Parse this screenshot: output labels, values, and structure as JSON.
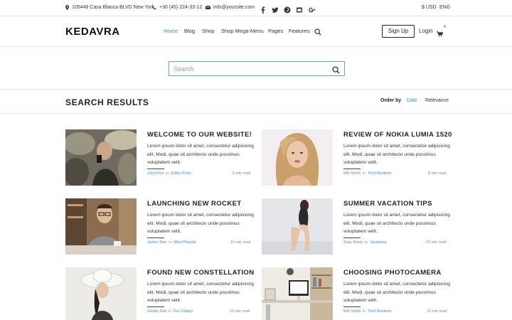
{
  "topbar": {
    "address": "105448 Casa Blanca BLVD New York",
    "phone": "+30 (45) 224-33-12",
    "email": "info@yoursite.com",
    "social": [
      "facebook-icon",
      "twitter-icon",
      "pinterest-icon",
      "youtube-icon",
      "google-plus-icon"
    ],
    "currency": "$ USD",
    "language": "ENG"
  },
  "header": {
    "logo": "KEDAVRA",
    "nav": [
      "Home",
      "Blog",
      "Shop",
      "Shop Mega-Menu",
      "Pages",
      "Features"
    ],
    "active_nav": "Home",
    "signup": "Sign Up",
    "login": "Login",
    "cart_count": "4"
  },
  "search": {
    "placeholder": "Search"
  },
  "results": {
    "title": "SEARCH RESULTS",
    "order_by_label": "Order by",
    "order_date": "Date",
    "order_sep": "-",
    "order_relevance": "Relevance"
  },
  "posts": [
    {
      "title": "WELCOME TO OUR WEBSITE!",
      "excerpt": "Lorem ipsum dolor sit amet, consectetur adipisicing elit. Modi, quae sit architecto unde possimus voluptatem velit.",
      "author": "John Doe",
      "in": "in",
      "category": "Editor Picks",
      "read": "5 min read"
    },
    {
      "title": "REVIEW OF NOKIA LUMIA 1520",
      "excerpt": "Lorem ipsum dolor sit amet, consectetur adipisicing elit. Modi, quae sit architecto unde possimus voluptatem velit.",
      "author": "Will Smith",
      "in": "in",
      "category": "Tech Reviews",
      "read": "8 min read"
    },
    {
      "title": "LAUNCHING NEW ROCKET",
      "excerpt": "Lorem ipsum dolor sit amet, consectetur adipisicing elit. Modi, quae sit architecto unde possimus voluptatem velit.",
      "author": "James Roe",
      "in": "in",
      "category": "Most Popular",
      "read": "10 min read"
    },
    {
      "title": "SUMMER VACATION TIPS",
      "excerpt": "Lorem ipsum dolor sit amet, consectetur adipisicing elit. Modi, quae sit architecto unde possimus voluptatem velit.",
      "author": "Susy Davis",
      "in": "in",
      "category": "Vacations",
      "read": "20 min read"
    },
    {
      "title": "FOUND NEW CONSTELLATION",
      "excerpt": "Lorem ipsum dolor sit amet, consectetur adipisicing elit. Modi, quae sit architecto unde possimus voluptatem velit.",
      "author": "Dexter Dirk",
      "in": "in",
      "category": "Our Galaxy",
      "read": "15 min read"
    },
    {
      "title": "CHOOSING PHOTOCAMERA",
      "excerpt": "Lorem ipsum dolor sit amet, consectetur adipisicing elit. Modi, quae sit architecto unde possimus voluptatem velit.",
      "author": "Will Smith",
      "in": "in",
      "category": "Tech Reviews",
      "read": "16 min read"
    }
  ],
  "colors": {
    "accent": "#3b8fd6",
    "search_border": "#5fa3d6",
    "text": "#333333"
  }
}
